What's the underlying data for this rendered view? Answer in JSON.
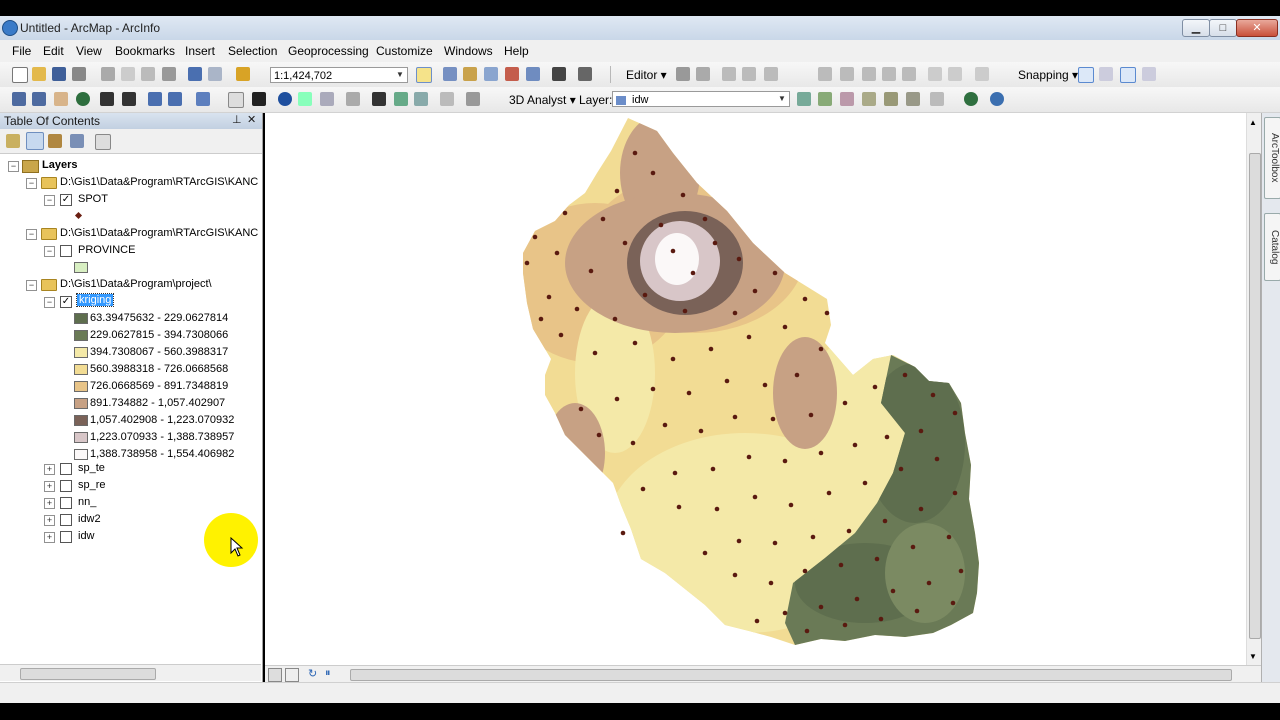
{
  "window": {
    "title": "Untitled - ArcMap - ArcInfo",
    "min": "▁",
    "max": "□",
    "close": "✕"
  },
  "menu": [
    "File",
    "Edit",
    "View",
    "Bookmarks",
    "Insert",
    "Selection",
    "Geoprocessing",
    "Customize",
    "Windows",
    "Help"
  ],
  "toolbar": {
    "scale": "1:1,424,702",
    "editor": "Editor ▾",
    "snapping": "Snapping ▾",
    "analyst": "3D Analyst ▾",
    "layer_label": "Layer:",
    "layer_value": "idw"
  },
  "toc": {
    "title": "Table Of Contents",
    "root": "Layers",
    "groups": [
      {
        "path": "D:\\Gis1\\Data&Program\\RTArcGIS\\KANC",
        "layer": "SPOT",
        "checked": "✓"
      },
      {
        "path": "D:\\Gis1\\Data&Program\\RTArcGIS\\KANC",
        "layer": "PROVINCE",
        "checked": ""
      },
      {
        "path": "D:\\Gis1\\Data&Program\\project\\",
        "layer": "kriging",
        "checked": "✓"
      }
    ],
    "legend": [
      {
        "label": "63.39475632 - 229.0627814",
        "color": "#5e6e4e"
      },
      {
        "label": "229.0627815 - 394.7308066",
        "color": "#6a7a56"
      },
      {
        "label": "394.7308067 - 560.3988317",
        "color": "#f4e9a8"
      },
      {
        "label": "560.3988318 - 726.0668568",
        "color": "#f2dc94"
      },
      {
        "label": "726.0668569 - 891.7348819",
        "color": "#e8c488"
      },
      {
        "label": "891.734882 - 1,057.402907",
        "color": "#c7a184"
      },
      {
        "label": "1,057.402908 - 1,223.070932",
        "color": "#7a6258"
      },
      {
        "label": "1,223.070933 - 1,388.738957",
        "color": "#d8c6c8"
      },
      {
        "label": "1,388.738958 - 1,554.406982",
        "color": "#fbf8f8"
      }
    ],
    "others": [
      "sp_te",
      "sp_re",
      "nn_",
      "idw2",
      "idw"
    ]
  },
  "dock": [
    "ArcToolbox",
    "Catalog"
  ]
}
